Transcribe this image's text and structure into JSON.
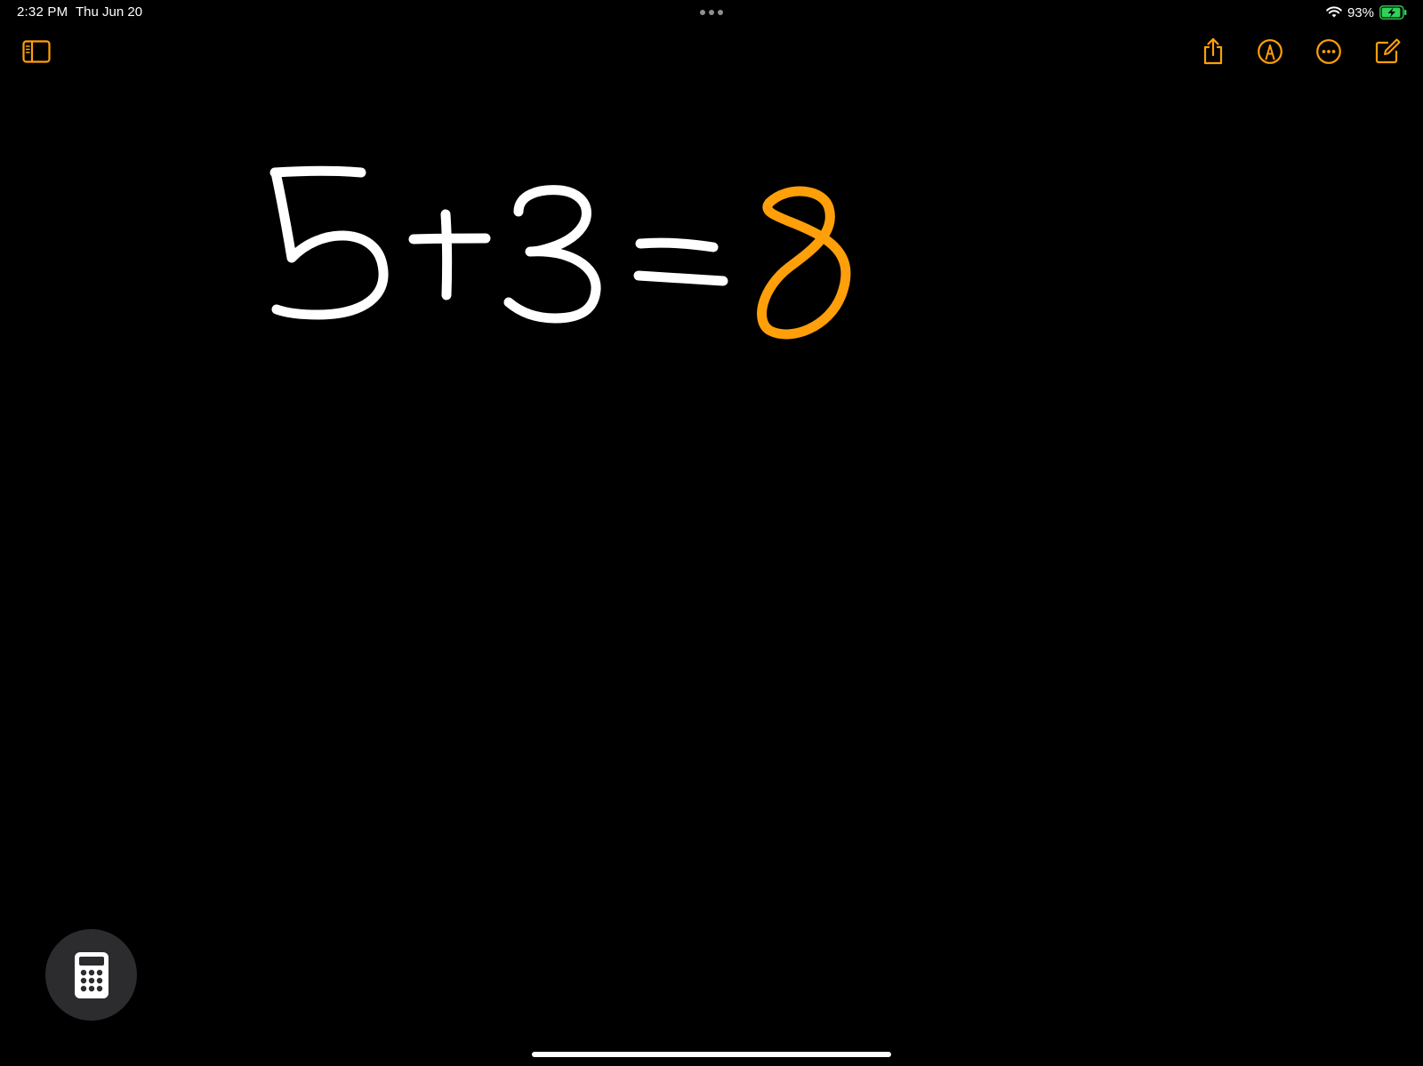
{
  "status_bar": {
    "time": "2:32 PM",
    "date": "Thu Jun 20",
    "battery_percent": "93%",
    "battery_level": 0.93,
    "charging": true,
    "battery_color": "#30d158",
    "wifi": "wifi-icon"
  },
  "toolbar": {
    "accent_color": "#ff9f0a",
    "left": [
      {
        "name": "sidebar-toggle-icon"
      }
    ],
    "right": [
      {
        "name": "share-icon"
      },
      {
        "name": "markup-pen-icon"
      },
      {
        "name": "more-icon"
      },
      {
        "name": "compose-icon"
      }
    ]
  },
  "note": {
    "handwritten_expression": "5+3=",
    "handwritten_result": "8",
    "ink_color": "#ffffff",
    "result_color": "#ff9f0a"
  },
  "calculator_button": {
    "icon": "calculator-icon",
    "background": "#2c2c2e"
  }
}
